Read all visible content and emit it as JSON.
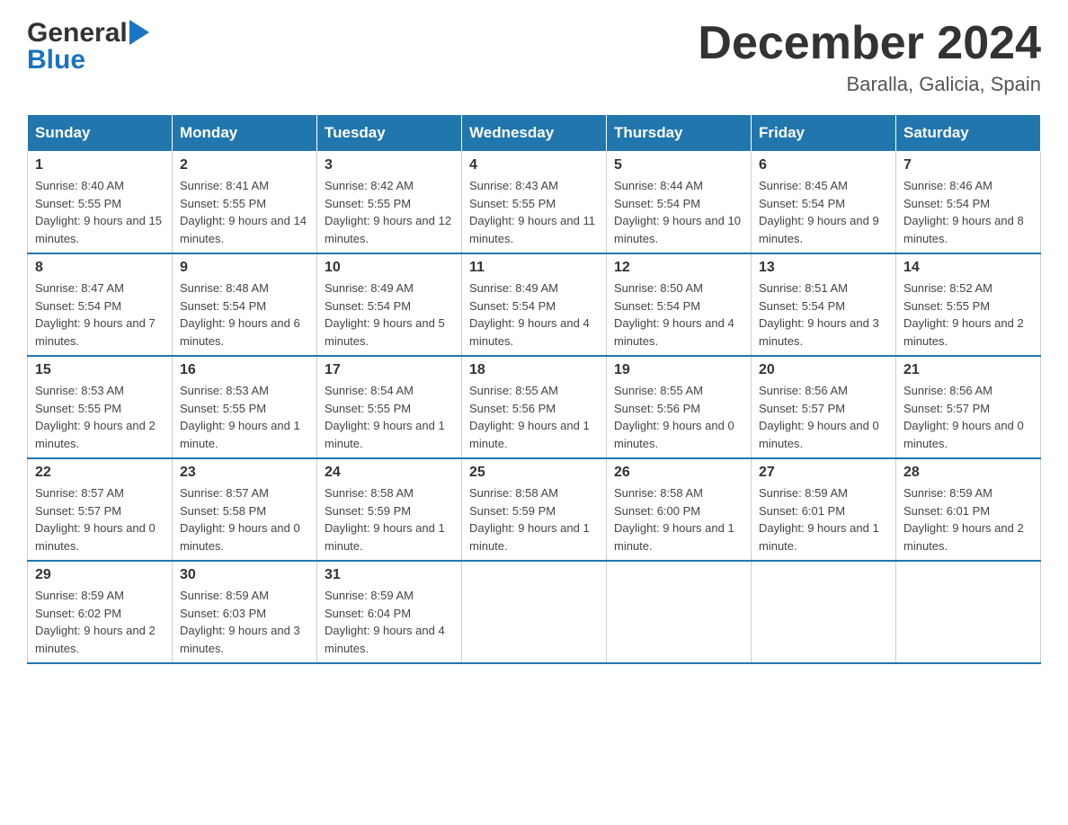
{
  "logo": {
    "general": "General",
    "blue": "Blue",
    "arrow": "▶"
  },
  "title": "December 2024",
  "location": "Baralla, Galicia, Spain",
  "header_days": [
    "Sunday",
    "Monday",
    "Tuesday",
    "Wednesday",
    "Thursday",
    "Friday",
    "Saturday"
  ],
  "weeks": [
    [
      {
        "day": "1",
        "sunrise": "Sunrise: 8:40 AM",
        "sunset": "Sunset: 5:55 PM",
        "daylight": "Daylight: 9 hours and 15 minutes."
      },
      {
        "day": "2",
        "sunrise": "Sunrise: 8:41 AM",
        "sunset": "Sunset: 5:55 PM",
        "daylight": "Daylight: 9 hours and 14 minutes."
      },
      {
        "day": "3",
        "sunrise": "Sunrise: 8:42 AM",
        "sunset": "Sunset: 5:55 PM",
        "daylight": "Daylight: 9 hours and 12 minutes."
      },
      {
        "day": "4",
        "sunrise": "Sunrise: 8:43 AM",
        "sunset": "Sunset: 5:55 PM",
        "daylight": "Daylight: 9 hours and 11 minutes."
      },
      {
        "day": "5",
        "sunrise": "Sunrise: 8:44 AM",
        "sunset": "Sunset: 5:54 PM",
        "daylight": "Daylight: 9 hours and 10 minutes."
      },
      {
        "day": "6",
        "sunrise": "Sunrise: 8:45 AM",
        "sunset": "Sunset: 5:54 PM",
        "daylight": "Daylight: 9 hours and 9 minutes."
      },
      {
        "day": "7",
        "sunrise": "Sunrise: 8:46 AM",
        "sunset": "Sunset: 5:54 PM",
        "daylight": "Daylight: 9 hours and 8 minutes."
      }
    ],
    [
      {
        "day": "8",
        "sunrise": "Sunrise: 8:47 AM",
        "sunset": "Sunset: 5:54 PM",
        "daylight": "Daylight: 9 hours and 7 minutes."
      },
      {
        "day": "9",
        "sunrise": "Sunrise: 8:48 AM",
        "sunset": "Sunset: 5:54 PM",
        "daylight": "Daylight: 9 hours and 6 minutes."
      },
      {
        "day": "10",
        "sunrise": "Sunrise: 8:49 AM",
        "sunset": "Sunset: 5:54 PM",
        "daylight": "Daylight: 9 hours and 5 minutes."
      },
      {
        "day": "11",
        "sunrise": "Sunrise: 8:49 AM",
        "sunset": "Sunset: 5:54 PM",
        "daylight": "Daylight: 9 hours and 4 minutes."
      },
      {
        "day": "12",
        "sunrise": "Sunrise: 8:50 AM",
        "sunset": "Sunset: 5:54 PM",
        "daylight": "Daylight: 9 hours and 4 minutes."
      },
      {
        "day": "13",
        "sunrise": "Sunrise: 8:51 AM",
        "sunset": "Sunset: 5:54 PM",
        "daylight": "Daylight: 9 hours and 3 minutes."
      },
      {
        "day": "14",
        "sunrise": "Sunrise: 8:52 AM",
        "sunset": "Sunset: 5:55 PM",
        "daylight": "Daylight: 9 hours and 2 minutes."
      }
    ],
    [
      {
        "day": "15",
        "sunrise": "Sunrise: 8:53 AM",
        "sunset": "Sunset: 5:55 PM",
        "daylight": "Daylight: 9 hours and 2 minutes."
      },
      {
        "day": "16",
        "sunrise": "Sunrise: 8:53 AM",
        "sunset": "Sunset: 5:55 PM",
        "daylight": "Daylight: 9 hours and 1 minute."
      },
      {
        "day": "17",
        "sunrise": "Sunrise: 8:54 AM",
        "sunset": "Sunset: 5:55 PM",
        "daylight": "Daylight: 9 hours and 1 minute."
      },
      {
        "day": "18",
        "sunrise": "Sunrise: 8:55 AM",
        "sunset": "Sunset: 5:56 PM",
        "daylight": "Daylight: 9 hours and 1 minute."
      },
      {
        "day": "19",
        "sunrise": "Sunrise: 8:55 AM",
        "sunset": "Sunset: 5:56 PM",
        "daylight": "Daylight: 9 hours and 0 minutes."
      },
      {
        "day": "20",
        "sunrise": "Sunrise: 8:56 AM",
        "sunset": "Sunset: 5:57 PM",
        "daylight": "Daylight: 9 hours and 0 minutes."
      },
      {
        "day": "21",
        "sunrise": "Sunrise: 8:56 AM",
        "sunset": "Sunset: 5:57 PM",
        "daylight": "Daylight: 9 hours and 0 minutes."
      }
    ],
    [
      {
        "day": "22",
        "sunrise": "Sunrise: 8:57 AM",
        "sunset": "Sunset: 5:57 PM",
        "daylight": "Daylight: 9 hours and 0 minutes."
      },
      {
        "day": "23",
        "sunrise": "Sunrise: 8:57 AM",
        "sunset": "Sunset: 5:58 PM",
        "daylight": "Daylight: 9 hours and 0 minutes."
      },
      {
        "day": "24",
        "sunrise": "Sunrise: 8:58 AM",
        "sunset": "Sunset: 5:59 PM",
        "daylight": "Daylight: 9 hours and 1 minute."
      },
      {
        "day": "25",
        "sunrise": "Sunrise: 8:58 AM",
        "sunset": "Sunset: 5:59 PM",
        "daylight": "Daylight: 9 hours and 1 minute."
      },
      {
        "day": "26",
        "sunrise": "Sunrise: 8:58 AM",
        "sunset": "Sunset: 6:00 PM",
        "daylight": "Daylight: 9 hours and 1 minute."
      },
      {
        "day": "27",
        "sunrise": "Sunrise: 8:59 AM",
        "sunset": "Sunset: 6:01 PM",
        "daylight": "Daylight: 9 hours and 1 minute."
      },
      {
        "day": "28",
        "sunrise": "Sunrise: 8:59 AM",
        "sunset": "Sunset: 6:01 PM",
        "daylight": "Daylight: 9 hours and 2 minutes."
      }
    ],
    [
      {
        "day": "29",
        "sunrise": "Sunrise: 8:59 AM",
        "sunset": "Sunset: 6:02 PM",
        "daylight": "Daylight: 9 hours and 2 minutes."
      },
      {
        "day": "30",
        "sunrise": "Sunrise: 8:59 AM",
        "sunset": "Sunset: 6:03 PM",
        "daylight": "Daylight: 9 hours and 3 minutes."
      },
      {
        "day": "31",
        "sunrise": "Sunrise: 8:59 AM",
        "sunset": "Sunset: 6:04 PM",
        "daylight": "Daylight: 9 hours and 4 minutes."
      },
      null,
      null,
      null,
      null
    ]
  ]
}
